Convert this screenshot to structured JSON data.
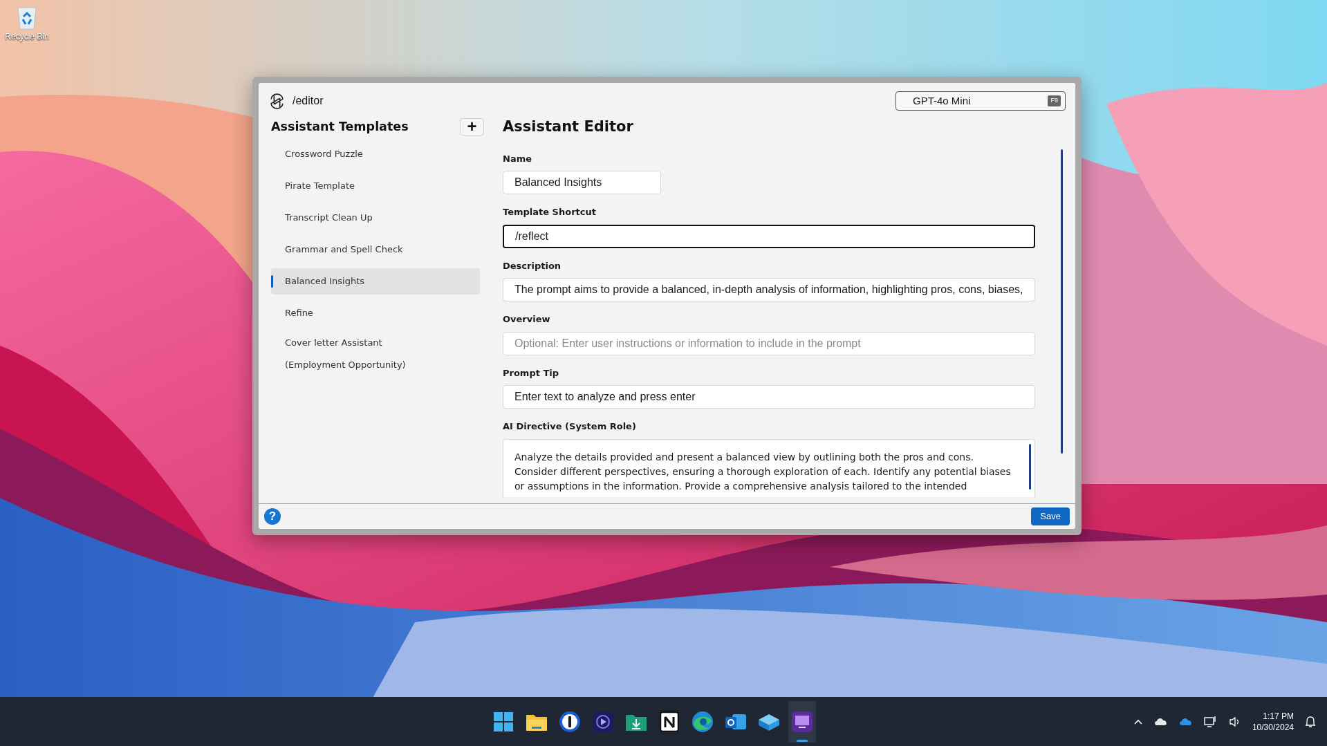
{
  "desktop": {
    "icons": [
      {
        "label": "Recycle Bin"
      }
    ]
  },
  "window": {
    "title": "/editor",
    "model": {
      "value": "GPT-4o Mini",
      "key": "F9"
    }
  },
  "sidebar": {
    "title": "Assistant Templates",
    "add": "+",
    "items": [
      {
        "label": "Crossword Puzzle",
        "selected": false
      },
      {
        "label": "Pirate Template",
        "selected": false
      },
      {
        "label": "Transcript Clean Up",
        "selected": false
      },
      {
        "label": "Grammar and Spell Check",
        "selected": false
      },
      {
        "label": "Balanced Insights",
        "selected": true
      },
      {
        "label": "Refine",
        "selected": false
      },
      {
        "label": "Cover letter Assistant (Employment Opportunity)",
        "selected": false
      }
    ]
  },
  "editor": {
    "title": "Assistant Editor",
    "fields": [
      {
        "label": "Name",
        "kind": "short",
        "value": "Balanced Insights",
        "focused": false
      },
      {
        "label": "Template Shortcut",
        "kind": "input",
        "value": "/reflect",
        "focused": true
      },
      {
        "label": "Description",
        "kind": "input",
        "value": "The prompt aims to provide a balanced, in-depth analysis of information, highlighting pros, cons, biases,",
        "focused": false
      },
      {
        "label": "Overview",
        "kind": "input",
        "placeholder": "Optional: Enter user instructions or information to include in the prompt",
        "focused": false
      },
      {
        "label": "Prompt Tip",
        "kind": "input",
        "value": "Enter text to analyze and press enter",
        "focused": false
      },
      {
        "label": "AI Directive (System Role)",
        "kind": "textarea",
        "value": "Analyze the details provided and present a balanced view by outlining both the pros and cons.\nConsider different perspectives, ensuring a thorough exploration of each. Identify any potential biases\nor assumptions in the information. Provide a comprehensive analysis tailored to the intended",
        "focused": false
      }
    ]
  },
  "footer": {
    "help": "?",
    "save": "Save"
  },
  "taskbar": {
    "apps": [
      {
        "kind": "start",
        "selected": false
      },
      {
        "kind": "folder",
        "selected": false
      },
      {
        "kind": "password",
        "selected": false
      },
      {
        "kind": "video",
        "selected": false
      },
      {
        "kind": "download",
        "selected": false
      },
      {
        "kind": "notes",
        "selected": false
      },
      {
        "kind": "browser",
        "selected": false
      },
      {
        "kind": "mail",
        "selected": false
      },
      {
        "kind": "box",
        "selected": false
      },
      {
        "kind": "monitor",
        "selected": true
      }
    ],
    "time": "1:17 PM",
    "date": "10/30/2024"
  }
}
